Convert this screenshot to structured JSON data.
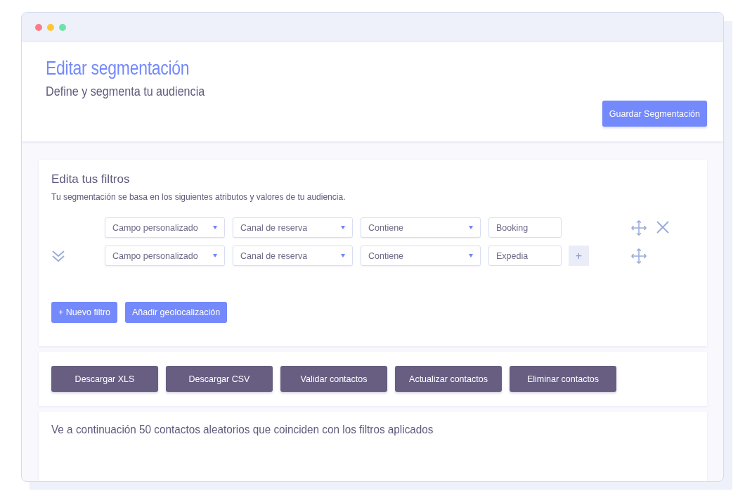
{
  "window": {
    "controls": [
      {
        "color": "#ff7b86"
      },
      {
        "color": "#ffc62e"
      },
      {
        "color": "#6de3a8"
      }
    ]
  },
  "header": {
    "title": "Editar segmentación",
    "subtitle": "Define y segmenta tu audiencia",
    "save_button": "Guardar Segmentación"
  },
  "filters": {
    "title": "Edita tus filtros",
    "description": "Tu segmentación se basa en los siguientes atributos y valores de tu audiencia.",
    "rows": [
      {
        "collapse_icon": false,
        "delete_icon": true,
        "fields": [
          {
            "kind": "select",
            "value": "Campo personalizado"
          },
          {
            "kind": "select",
            "value": "Canal de reserva"
          },
          {
            "kind": "select",
            "value": "Contiene"
          },
          {
            "kind": "text",
            "value": "Booking"
          }
        ]
      },
      {
        "collapse_icon": true,
        "delete_icon": false,
        "add_label": "+",
        "fields": [
          {
            "kind": "select",
            "value": "Campo personalizado"
          },
          {
            "kind": "select",
            "value": "Canal de reserva"
          },
          {
            "kind": "select",
            "value": "Contiene"
          },
          {
            "kind": "text",
            "value": "Expedia"
          }
        ]
      }
    ],
    "buttons": [
      "+ Nuevo filtro",
      "Añadir geolocalización"
    ]
  },
  "actions": [
    "Descargar XLS",
    "Descargar CSV",
    "Validar contactos",
    "Actualizar contactos",
    "Eliminar contactos"
  ],
  "results": {
    "text": "Ve a continuación 50 contactos aleatorios que coinciden con los filtros aplicados"
  }
}
